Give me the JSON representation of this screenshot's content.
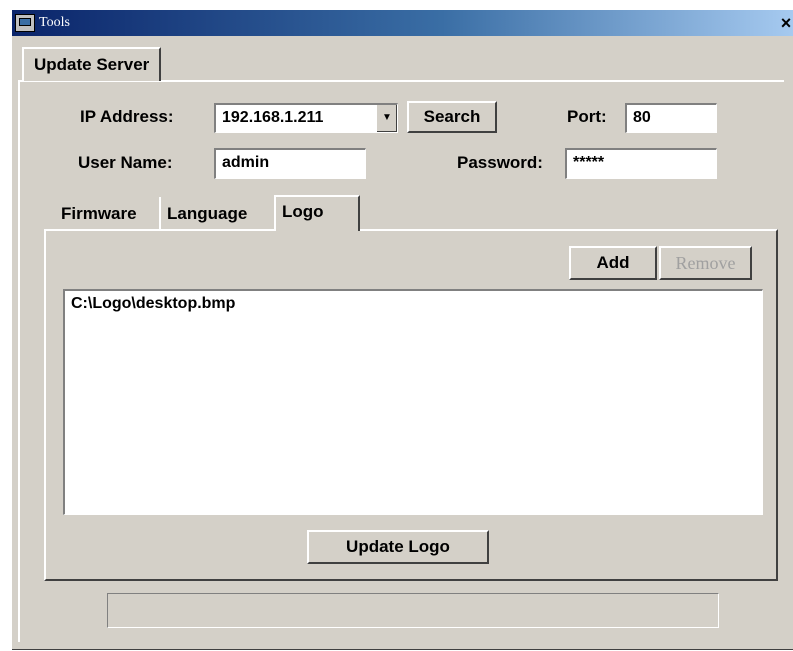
{
  "window": {
    "title": "Tools",
    "close_glyph": "×",
    "icon": "tools-app-icon"
  },
  "tabs": {
    "outer": [
      "Update Server"
    ],
    "inner": [
      "Firmware",
      "Language",
      "Logo"
    ]
  },
  "form": {
    "ip_label": "IP Address:",
    "ip_value": "192.168.1.211",
    "search_label": "Search",
    "port_label": "Port:",
    "port_value": "80",
    "user_label": "User Name:",
    "user_value": "admin",
    "password_label": "Password:",
    "password_value": "*****"
  },
  "logo_panel": {
    "add_label": "Add",
    "remove_label": "Remove",
    "files": [
      "C:\\Logo\\desktop.bmp"
    ],
    "update_label": "Update Logo"
  },
  "status": {
    "progress_text": ""
  }
}
